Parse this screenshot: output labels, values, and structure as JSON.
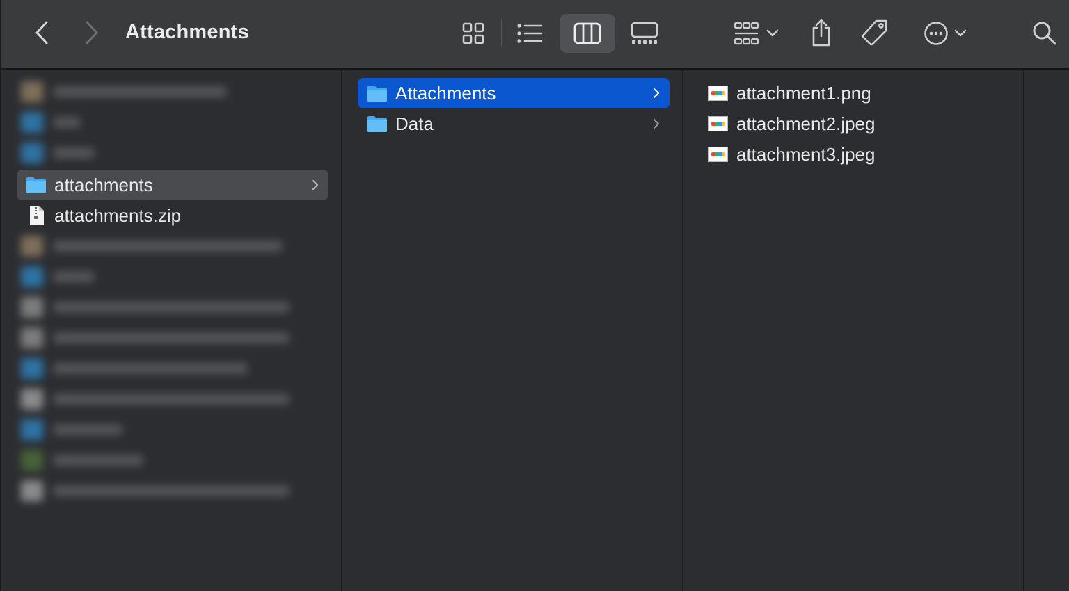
{
  "window": {
    "title": "Attachments"
  },
  "columns": {
    "col1": {
      "items": [
        {
          "name": "attachments",
          "kind": "folder",
          "state": "selected-inactive",
          "has_chevron": true
        },
        {
          "name": "attachments.zip",
          "kind": "file",
          "has_chevron": false
        }
      ]
    },
    "col2": {
      "items": [
        {
          "name": "Attachments",
          "kind": "folder",
          "state": "selected-active",
          "has_chevron": true
        },
        {
          "name": "Data",
          "kind": "folder",
          "has_chevron": true
        }
      ]
    },
    "col3": {
      "items": [
        {
          "name": "attachment1.png",
          "kind": "image"
        },
        {
          "name": "attachment2.jpeg",
          "kind": "image"
        },
        {
          "name": "attachment3.jpeg",
          "kind": "image"
        }
      ]
    }
  },
  "toolbar": {
    "icons": [
      "back-icon",
      "forward-icon",
      "icon-view-icon",
      "list-view-icon",
      "column-view-icon",
      "gallery-view-icon",
      "group-icon",
      "share-icon",
      "tag-icon",
      "more-actions-icon",
      "search-icon"
    ],
    "active_view": "column-view"
  },
  "colors": {
    "accent_blue": "#0b57d0",
    "folder_blue": "#3fa9f5",
    "selection_grey": "#4a4b4f"
  }
}
